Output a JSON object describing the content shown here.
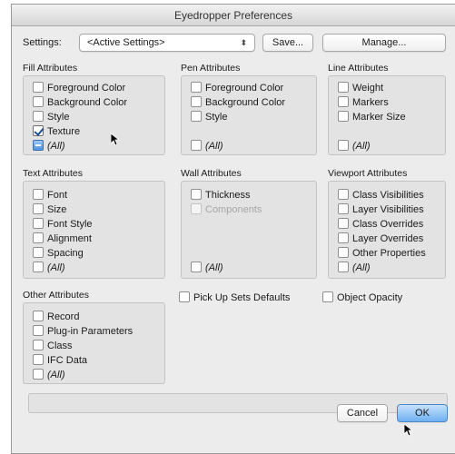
{
  "window": {
    "title": "Eyedropper Preferences"
  },
  "settings": {
    "label": "Settings:",
    "selected": "<Active Settings>",
    "stepper_glyph": "⬍",
    "save_label": "Save...",
    "manage_label": "Manage..."
  },
  "fill": {
    "title": "Fill Attributes",
    "items": [
      {
        "label": "Foreground Color",
        "checked": false
      },
      {
        "label": "Background Color",
        "checked": false
      },
      {
        "label": "Style",
        "checked": false
      },
      {
        "label": "Texture",
        "checked": true
      },
      {
        "label": "(All)",
        "state": "mixed"
      }
    ]
  },
  "pen": {
    "title": "Pen Attributes",
    "items": [
      {
        "label": "Foreground Color",
        "checked": false
      },
      {
        "label": "Background Color",
        "checked": false
      },
      {
        "label": "Style",
        "checked": false
      },
      {
        "label": "(All)",
        "checked": false
      }
    ]
  },
  "line": {
    "title": "Line Attributes",
    "items": [
      {
        "label": "Weight",
        "checked": false
      },
      {
        "label": "Markers",
        "checked": false
      },
      {
        "label": "Marker Size",
        "checked": false
      },
      {
        "label": "(All)",
        "checked": false
      }
    ]
  },
  "text": {
    "title": "Text Attributes",
    "items": [
      {
        "label": "Font",
        "checked": false
      },
      {
        "label": "Size",
        "checked": false
      },
      {
        "label": "Font Style",
        "checked": false
      },
      {
        "label": "Alignment",
        "checked": false
      },
      {
        "label": "Spacing",
        "checked": false
      },
      {
        "label": "(All)",
        "checked": false
      }
    ]
  },
  "wall": {
    "title": "Wall Attributes",
    "items": [
      {
        "label": "Thickness",
        "checked": false
      },
      {
        "label": "Components",
        "checked": false,
        "disabled": true
      },
      {
        "label": "(All)",
        "checked": false
      }
    ]
  },
  "viewport": {
    "title": "Viewport Attributes",
    "items": [
      {
        "label": "Class Visibilities",
        "checked": false
      },
      {
        "label": "Layer Visibilities",
        "checked": false
      },
      {
        "label": "Class Overrides",
        "checked": false
      },
      {
        "label": "Layer Overrides",
        "checked": false
      },
      {
        "label": "Other Properties",
        "checked": false
      },
      {
        "label": "(All)",
        "checked": false
      }
    ]
  },
  "other": {
    "title": "Other Attributes",
    "items": [
      {
        "label": "Record",
        "checked": false
      },
      {
        "label": "Plug-in Parameters",
        "checked": false
      },
      {
        "label": "Class",
        "checked": false
      },
      {
        "label": "IFC Data",
        "checked": false
      },
      {
        "label": "(All)",
        "checked": false
      }
    ]
  },
  "options": {
    "pick_up_sets_defaults": {
      "label": "Pick Up Sets Defaults",
      "checked": false
    },
    "object_opacity": {
      "label": "Object Opacity",
      "checked": false
    }
  },
  "buttons": {
    "cancel_label": "Cancel",
    "ok_label": "OK"
  },
  "colors": {
    "default_button": "#6fb1f2",
    "check": "#1c4f93",
    "group_bg": "#e3e3e3"
  },
  "icons": {
    "pointer": "arrow-cursor-icon"
  }
}
